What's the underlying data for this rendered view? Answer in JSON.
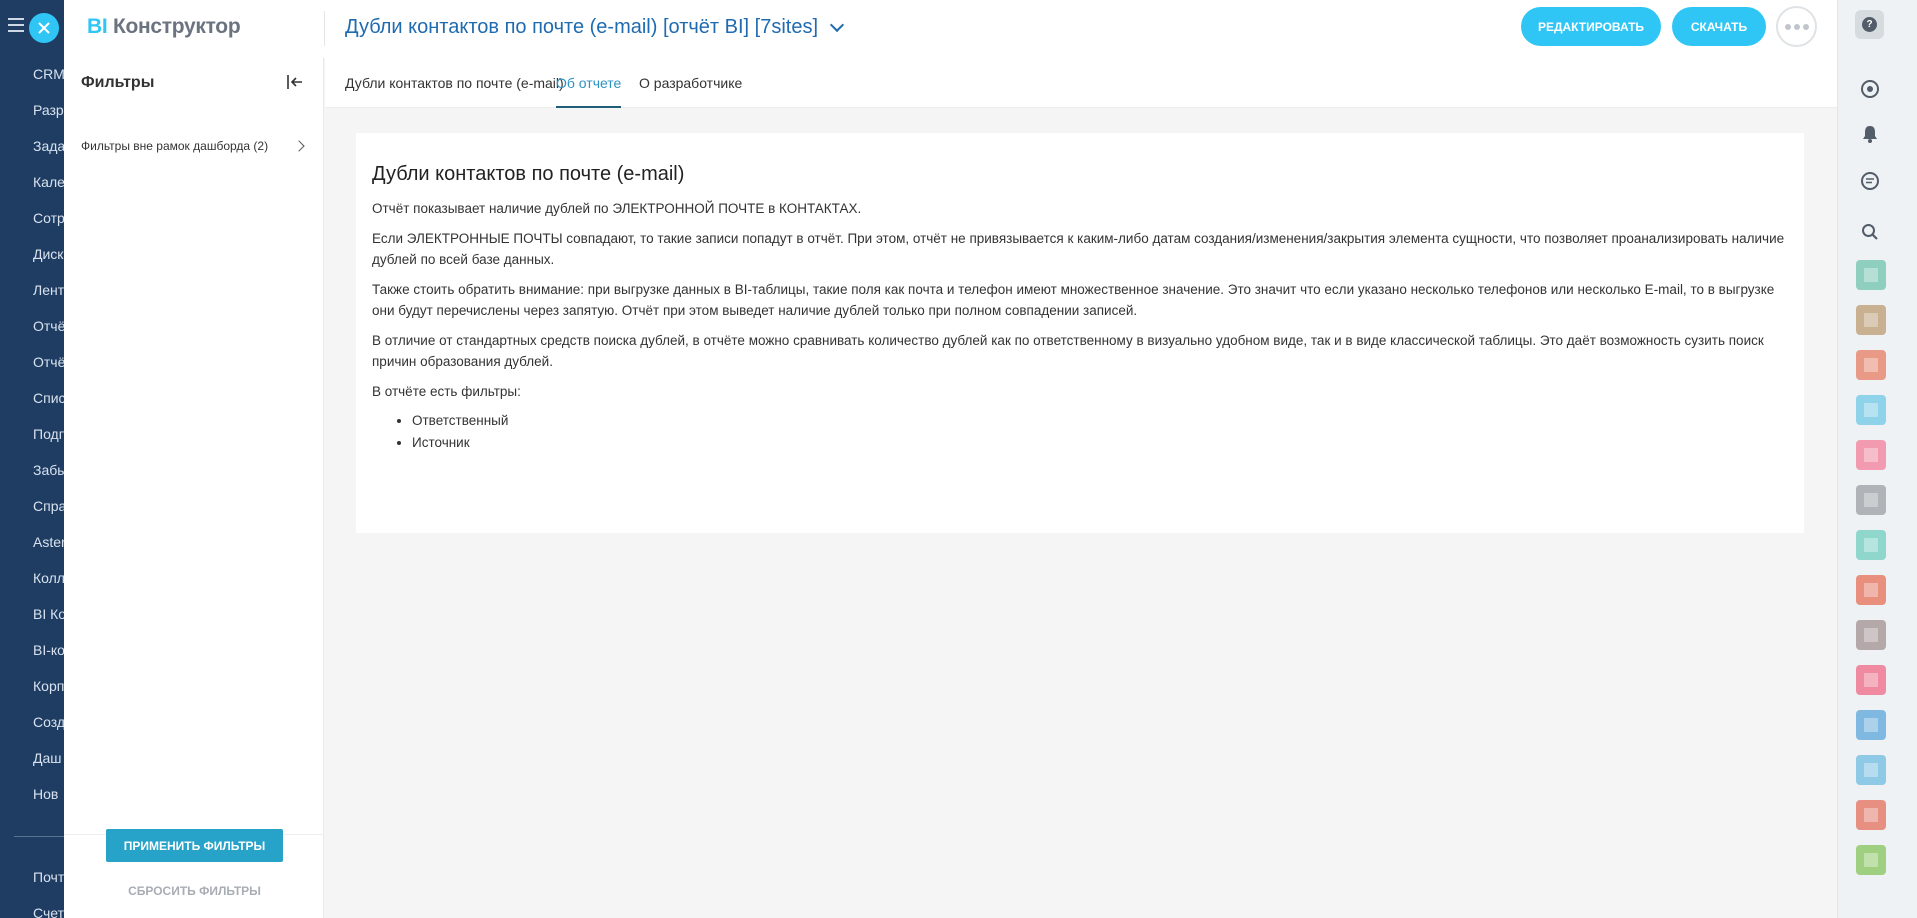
{
  "left_menu": {
    "items": [
      "CRM",
      "Разр",
      "Зада",
      "Кале",
      "Сотр",
      "Диск",
      "Лент",
      "Отчё",
      "Отчё",
      "Спис",
      "Подп",
      "Забы",
      "Спра",
      "Aster",
      "Колл",
      "BI Ко",
      "BI-ко",
      "Корп",
      "Созд",
      "Даш",
      "Нов"
    ],
    "bottom_items": [
      "Почт",
      "Счет"
    ]
  },
  "header": {
    "logo_bi": "BI",
    "logo_rest": "Конструктор",
    "report_title": "Дубли контактов по почте (e-mail) [отчёт BI] [7sites]",
    "edit_label": "РЕДАКТИРОВАТЬ",
    "download_label": "СКАЧАТЬ"
  },
  "filters": {
    "title": "Фильтры",
    "group_label": "Фильтры вне рамок дашборда (2)",
    "apply_label": "ПРИМЕНИТЬ ФИЛЬТРЫ",
    "reset_label": "СБРОСИТЬ ФИЛЬТРЫ"
  },
  "tabs": [
    {
      "label": "Дубли контактов по почте (e-mail)",
      "active": false
    },
    {
      "label": "Об отчете",
      "active": true
    },
    {
      "label": "О разработчике",
      "active": false
    }
  ],
  "content": {
    "heading": "Дубли контактов по почте (e-mail)",
    "paragraphs": [
      "Отчёт показывает наличие дублей по ЭЛЕКТРОННОЙ ПОЧТЕ в КОНТАКТАХ.",
      "Если ЭЛЕКТРОННЫЕ ПОЧТЫ совпадают, то такие записи попадут в отчёт. При этом, отчёт не привязывается к каким-либо датам создания/изменения/закрытия элемента сущности, что позволяет проанализировать наличие дублей по всей базе данных.",
      "Также стоить обратить внимание: при выгрузке данных в BI-таблицы, такие поля как почта и телефон имеют множественное значение. Это значит что если указано несколько телефонов или несколько E-mail, то в выгрузке они будут перечислены через запятую. Отчёт при этом выведет наличие дублей только при полном совпадении записей.",
      "В отличие от стандартных средств поиска дублей, в отчёте можно сравнивать количество дублей как по ответственному в визуально удобном виде, так и в виде классической таблицы. Это даёт возможность сузить поиск причин образования дублей.",
      "В отчёте есть фильтры:"
    ],
    "list": [
      "Ответственный",
      "Источник"
    ]
  },
  "rightbar": {
    "help_glyph": "?",
    "avatar_colors": [
      "#8fcfbf",
      "#c8b090",
      "#e89a86",
      "#8fd3ea",
      "#f29ab0",
      "#b0b4b8",
      "#8fd6cc",
      "#e88f7e",
      "#b4a8a8",
      "#f08aa0",
      "#7fb8e0",
      "#8ec9e6",
      "#e79082",
      "#9fcf80"
    ]
  },
  "colors": {
    "accent": "#2fc6f6",
    "title_blue": "#1f6bb0",
    "apply_button": "#27a2c8",
    "menu_bg": "#1f3d63"
  }
}
